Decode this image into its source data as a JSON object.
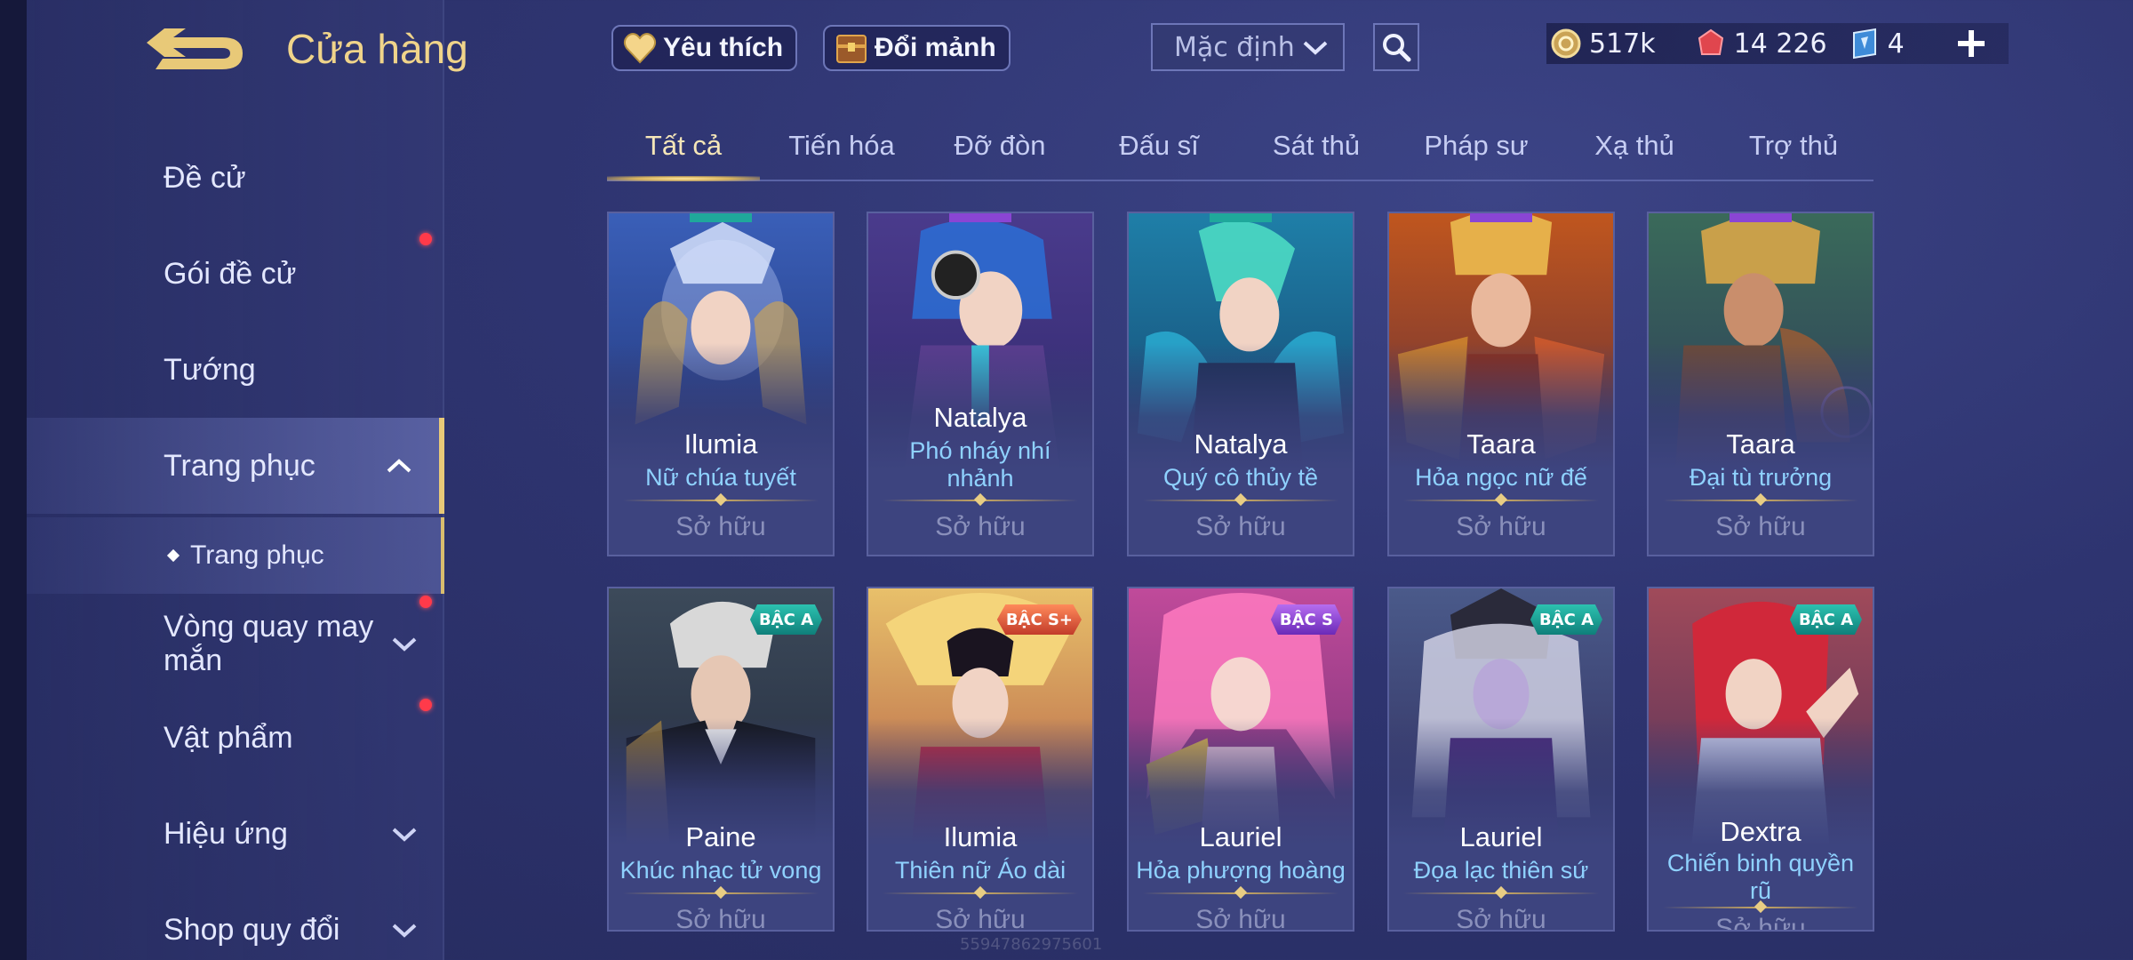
{
  "header": {
    "title": "Cửa hàng",
    "favorite_label": "Yêu thích",
    "exchange_label": "Đổi mảnh",
    "sort_value": "Mặc định"
  },
  "currency": {
    "gold": "517k",
    "vouchers": "14 226",
    "tickets": "4"
  },
  "sidebar": {
    "items": [
      {
        "label": "Đề cử"
      },
      {
        "label": "Gói đề cử"
      },
      {
        "label": "Tướng"
      },
      {
        "label": "Trang phục"
      },
      {
        "label": "Trang phục"
      },
      {
        "label": "Vòng quay may mắn"
      },
      {
        "label": "Vật phẩm"
      },
      {
        "label": "Hiệu ứng"
      },
      {
        "label": "Shop quy đổi"
      }
    ]
  },
  "tabs": [
    "Tất cả",
    "Tiến hóa",
    "Đỡ đòn",
    "Đấu sĩ",
    "Sát thủ",
    "Pháp sư",
    "Xạ thủ",
    "Trợ thủ"
  ],
  "cards": [
    {
      "hero": "Ilumia",
      "skin": "Nữ chúa tuyết",
      "status": "Sở hữu",
      "tier": ""
    },
    {
      "hero": "Natalya",
      "skin": "Phó nháy nhí nhảnh",
      "status": "Sở hữu",
      "tier": ""
    },
    {
      "hero": "Natalya",
      "skin": "Quý cô thủy tề",
      "status": "Sở hữu",
      "tier": ""
    },
    {
      "hero": "Taara",
      "skin": "Hỏa ngọc nữ đế",
      "status": "Sở hữu",
      "tier": ""
    },
    {
      "hero": "Taara",
      "skin": "Đại tù trưởng",
      "status": "Sở hữu",
      "tier": ""
    },
    {
      "hero": "Paine",
      "skin": "Khúc nhạc tử vong",
      "status": "Sở hữu",
      "tier": "BẬC A"
    },
    {
      "hero": "Ilumia",
      "skin": "Thiên nữ Áo dài",
      "status": "Sở hữu",
      "tier": "BẬC S+"
    },
    {
      "hero": "Lauriel",
      "skin": "Hỏa phượng hoàng",
      "status": "Sở hữu",
      "tier": "BẬC S"
    },
    {
      "hero": "Lauriel",
      "skin": "Đọa lạc thiên sứ",
      "status": "Sở hữu",
      "tier": "BẬC A"
    },
    {
      "hero": "Dextra",
      "skin": "Chiến binh quyền rũ",
      "status": "Sở hữu",
      "tier": "BẬC A"
    }
  ],
  "watermark": "55947862975601",
  "colors": {
    "accent_gold": "#e8c978",
    "skin_name": "#8fd2ff",
    "tier_a": "#1fa89b",
    "tier_s": "#8a45d4",
    "tier_s_plus": "#e05a3a",
    "notification": "#ff3a4a"
  },
  "icons": {
    "back": "back-arrow-icon",
    "favorite": "heart-icon",
    "exchange": "chest-icon",
    "search": "search-icon",
    "gold": "gold-coin-icon",
    "voucher": "red-gem-icon",
    "ticket": "ticket-icon",
    "add": "plus-icon"
  }
}
